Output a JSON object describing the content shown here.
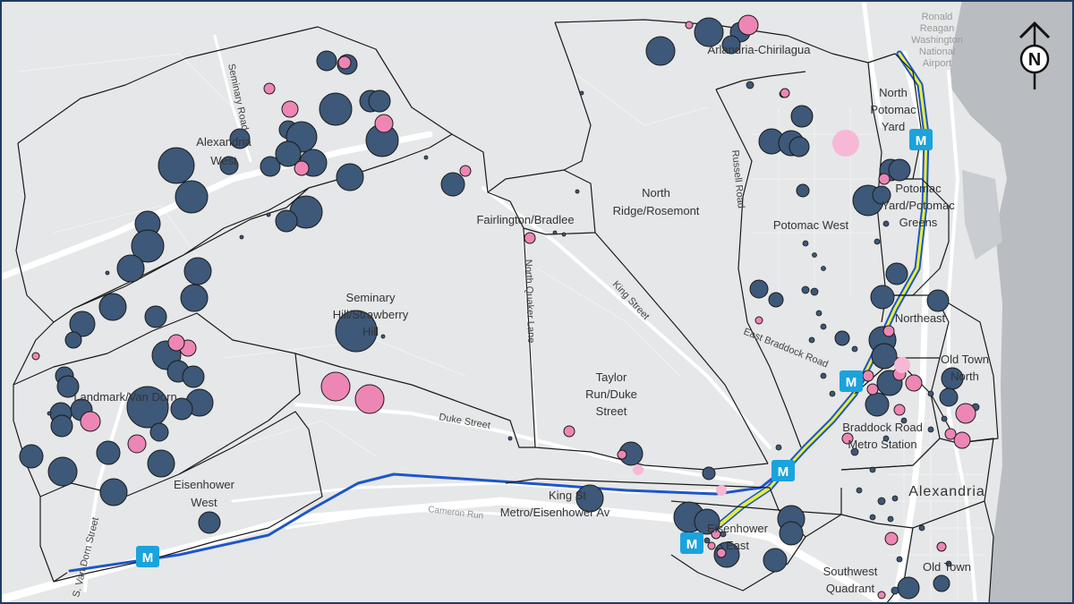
{
  "colors": {
    "land": "#e6e7e8",
    "water": "#b9bdc2",
    "roads": "#ffffff",
    "boundary": "#1a1a1a",
    "circle_blue": "#3d5878",
    "circle_pink": "#ee86b5",
    "circle_light_pink": "#f7b8d6",
    "metro_blue_line": "#1d56c9",
    "metro_yellow_line": "#e7ef3a",
    "metro_badge": "#1aa3dd",
    "frame": "#1f3b63"
  },
  "airport": {
    "line1": "Ronald",
    "line2": "Reagan",
    "line3": "Washington",
    "line4": "National",
    "line5": "Airport"
  },
  "compass": {
    "letter": "N",
    "icon": "north-arrow-icon"
  },
  "city_label": "Alexandria",
  "metro_letter": "M",
  "neighborhoods": {
    "arlandria": "Arlandria-Chirilagua",
    "alexandria_west_1": "Alexandria",
    "alexandria_west_2": "West",
    "seminary_1": "Seminary",
    "seminary_2": "Hill/Strawberry",
    "seminary_3": "Hill",
    "landmark": "Landmark/Van Dorn",
    "eisenhower_west_1": "Eisenhower",
    "eisenhower_west_2": "West",
    "fairlington": "Fairlington/Bradlee",
    "north_ridge_1": "North",
    "north_ridge_2": "Ridge/Rosemont",
    "taylor_1": "Taylor",
    "taylor_2": "Run/Duke",
    "taylor_3": "Street",
    "king_st_1": "King St",
    "king_st_2": "Metro/Eisenhower Av",
    "eisenhower_east_1": "Eisenhower",
    "eisenhower_east_2": "East",
    "potomac_west": "Potomac West",
    "north_potomac_1": "North",
    "north_potomac_2": "Potomac",
    "north_potomac_3": "Yard",
    "potomac_yard_1": "Potomac",
    "potomac_yard_2": "Yard/Potomac",
    "potomac_yard_3": "Greens",
    "northeast": "Northeast",
    "old_town_north_1": "Old Town",
    "old_town_north_2": "North",
    "braddock_1": "Braddock Road",
    "braddock_2": "Metro Station",
    "southwest_1": "Southwest",
    "southwest_2": "Quadrant",
    "old_town": "Old Town"
  },
  "roads": {
    "seminary_road": "Seminary Road",
    "north_quaker": "North Quaker Lane",
    "king_street": "King Street",
    "russell_road": "Russell Road",
    "east_braddock": "East Braddock Road",
    "duke_street": "Duke Street",
    "van_dorn": "S. Van Dorn Street",
    "cameron_run": "Cameron Run"
  }
}
